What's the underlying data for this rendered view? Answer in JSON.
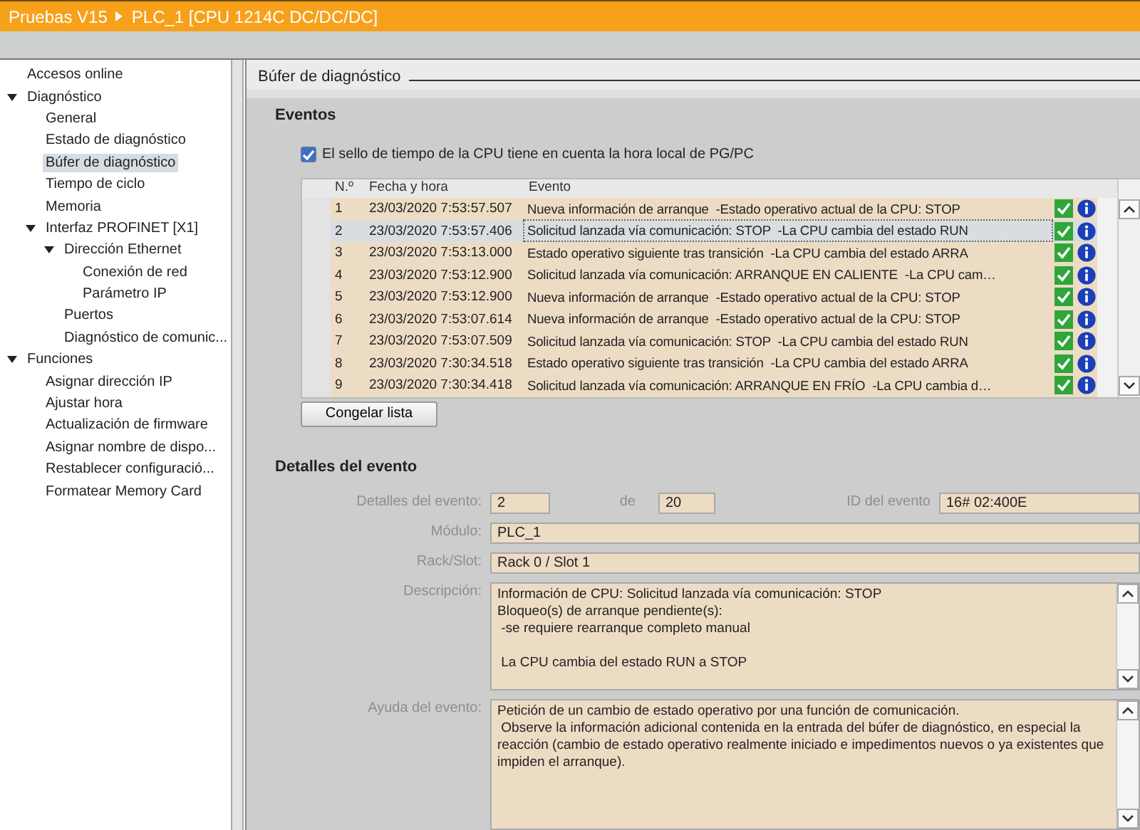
{
  "title_bar": {
    "project": "Pruebas V15",
    "device": "PLC_1 [CPU 1214C DC/DC/DC]"
  },
  "sidebar": {
    "items": [
      {
        "label": "Accesos online",
        "selected": false
      },
      {
        "label": "Diagnóstico",
        "selected": false,
        "expanded": true,
        "children": [
          {
            "label": "General",
            "selected": false
          },
          {
            "label": "Estado de diagnóstico",
            "selected": false
          },
          {
            "label": "Búfer de diagnóstico",
            "selected": true
          },
          {
            "label": "Tiempo de ciclo",
            "selected": false
          },
          {
            "label": "Memoria",
            "selected": false
          },
          {
            "label": "Interfaz PROFINET [X1]",
            "selected": false,
            "expanded": true,
            "children": [
              {
                "label": "Dirección Ethernet",
                "selected": false,
                "expanded": true,
                "children": [
                  {
                    "label": "Conexión de red",
                    "selected": false
                  },
                  {
                    "label": "Parámetro IP",
                    "selected": false
                  }
                ]
              },
              {
                "label": "Puertos",
                "selected": false
              },
              {
                "label": "Diagnóstico de comunic...",
                "selected": false
              }
            ]
          }
        ]
      },
      {
        "label": "Funciones",
        "selected": false,
        "expanded": true,
        "children": [
          {
            "label": "Asignar dirección IP",
            "selected": false
          },
          {
            "label": "Ajustar hora",
            "selected": false
          },
          {
            "label": "Actualización de firmware",
            "selected": false
          },
          {
            "label": "Asignar nombre de dispo...",
            "selected": false
          },
          {
            "label": "Restablecer configuració...",
            "selected": false
          },
          {
            "label": "Formatear Memory Card",
            "selected": false
          }
        ]
      }
    ]
  },
  "section_title": "Búfer de diagnóstico",
  "events": {
    "title": "Eventos",
    "local_time_checkbox": {
      "label": "El sello de tiempo de la CPU tiene en cuenta la hora local de PG/PC",
      "checked": true
    },
    "table": {
      "columns": [
        "N.º",
        "Fecha y hora",
        "Evento"
      ],
      "rows": [
        {
          "number": "1",
          "datetime": "23/03/2020 7:53:57.507",
          "event": "Nueva información de arranque  -Estado operativo actual de la CPU: STOP",
          "selected": false
        },
        {
          "number": "2",
          "datetime": "23/03/2020 7:53:57.406",
          "event": "Solicitud lanzada vía comunicación: STOP  -La CPU cambia del estado RUN",
          "selected": true
        },
        {
          "number": "3",
          "datetime": "23/03/2020 7:53:13.000",
          "event": "Estado operativo siguiente tras transición  -La CPU cambia del estado ARRA",
          "selected": false
        },
        {
          "number": "4",
          "datetime": "23/03/2020 7:53:12.900",
          "event": "Solicitud lanzada vía comunicación: ARRANQUE EN CALIENTE  -La CPU cam…",
          "selected": false
        },
        {
          "number": "5",
          "datetime": "23/03/2020 7:53:12.900",
          "event": "Nueva información de arranque  -Estado operativo actual de la CPU: STOP",
          "selected": false
        },
        {
          "number": "6",
          "datetime": "23/03/2020 7:53:07.614",
          "event": "Nueva información de arranque  -Estado operativo actual de la CPU: STOP",
          "selected": false
        },
        {
          "number": "7",
          "datetime": "23/03/2020 7:53:07.509",
          "event": "Solicitud lanzada vía comunicación: STOP  -La CPU cambia del estado RUN",
          "selected": false
        },
        {
          "number": "8",
          "datetime": "23/03/2020 7:30:34.518",
          "event": "Estado operativo siguiente tras transición  -La CPU cambia del estado ARRA",
          "selected": false
        },
        {
          "number": "9",
          "datetime": "23/03/2020 7:30:34.418",
          "event": "Solicitud lanzada vía comunicación: ARRANQUE EN FRÍO  -La CPU cambia d…",
          "selected": false
        }
      ]
    },
    "freeze_button": "Congelar lista"
  },
  "details": {
    "title": "Detalles del evento",
    "event_label": "Detalles del evento:",
    "event_index": "2",
    "of_label": "de",
    "event_total": "20",
    "id_label": "ID del evento",
    "id_value": "16# 02:400E",
    "module_label": "Módulo:",
    "module_value": "PLC_1",
    "rack_label": "Rack/Slot:",
    "rack_value": "Rack 0 / Slot 1",
    "description_label": "Descripción:",
    "description": "Información de CPU: Solicitud lanzada vía comunicación: STOP\nBloqueo(s) de arranque pendiente(s):\n -se requiere rearranque completo manual\n\n La CPU cambia del estado RUN a STOP",
    "help_label": "Ayuda del evento:",
    "help": "Petición de un cambio de estado operativo por una función de comunicación.\n Observe la información adicional contenida en la entrada del búfer de diagnóstico, en especial la reacción (cambio de estado operativo realmente iniciado e impedimentos nuevos o ya existentes que impiden el arranque)."
  }
}
